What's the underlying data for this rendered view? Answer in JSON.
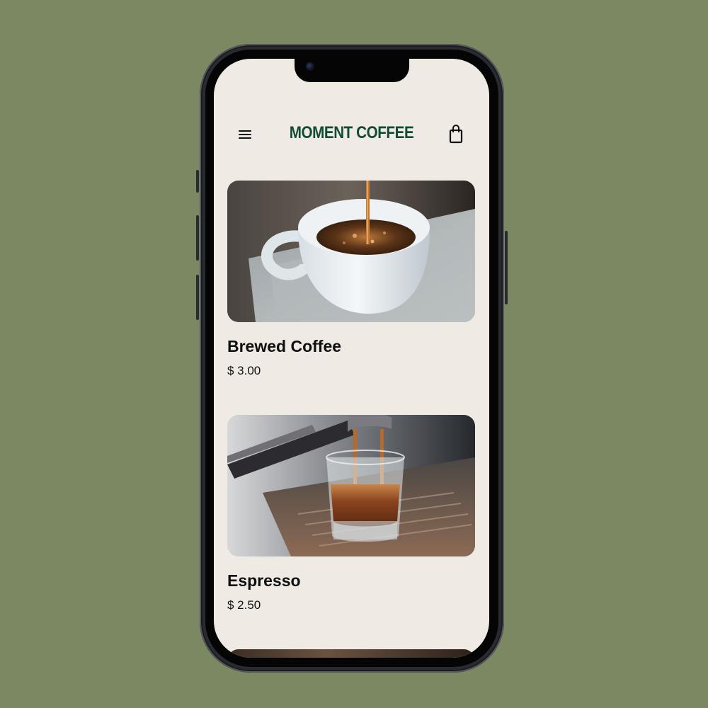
{
  "app": {
    "brand": "MOMENT COFFEE",
    "brand_color": "#134a33",
    "background_color": "#efebe4"
  },
  "header": {
    "menu_icon": "hamburger-menu-icon",
    "cart_icon": "shopping-bag-icon"
  },
  "products": [
    {
      "name": "Brewed Coffee",
      "price": "$ 3.00",
      "image": "coffee-cup-pour-photo"
    },
    {
      "name": "Espresso",
      "price": "$ 2.50",
      "image": "espresso-shot-photo"
    }
  ]
}
